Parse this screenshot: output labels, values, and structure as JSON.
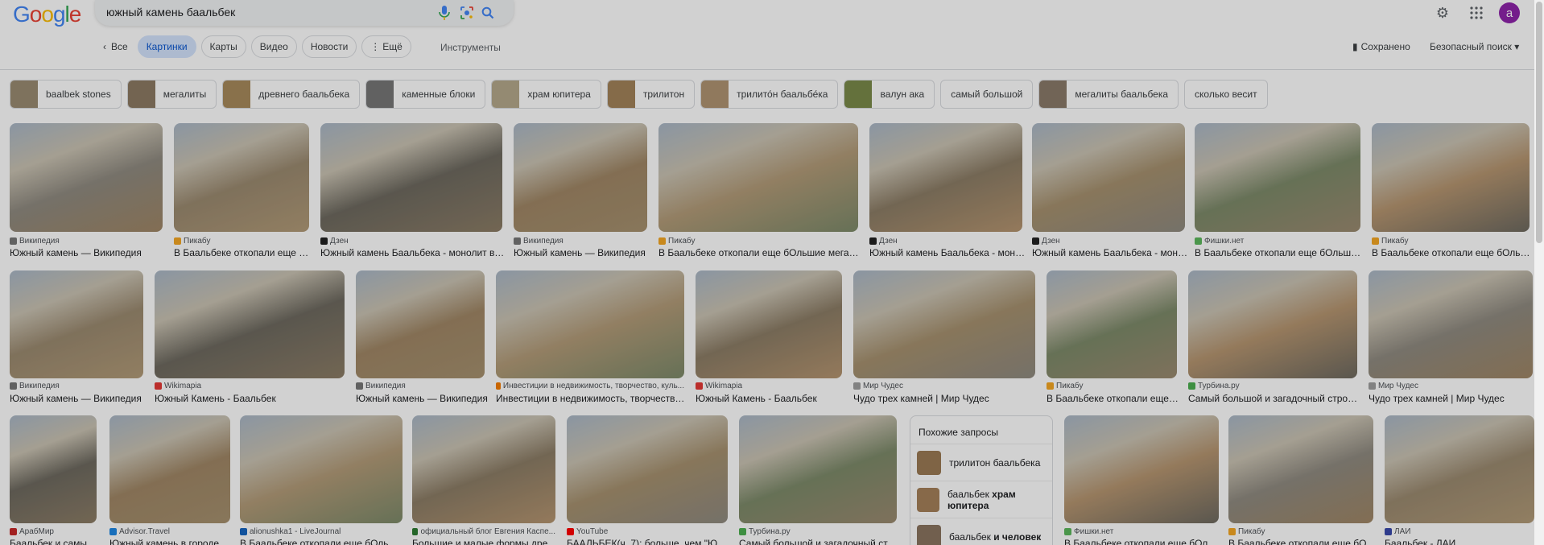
{
  "logo": {
    "letters": [
      "G",
      "o",
      "o",
      "g",
      "l",
      "e"
    ],
    "colors": [
      "#4285F4",
      "#EA4335",
      "#FBBC05",
      "#4285F4",
      "#34A853",
      "#EA4335"
    ]
  },
  "search": {
    "query": "южный камень баальбек"
  },
  "user": {
    "avatar_letter": "a",
    "avatar_color": "#8e24aa"
  },
  "tabs": [
    {
      "label": "Все"
    },
    {
      "label": "Картинки"
    },
    {
      "label": "Карты"
    },
    {
      "label": "Видео"
    },
    {
      "label": "Новости"
    },
    {
      "label": "Ещё"
    }
  ],
  "tools_label": "Инструменты",
  "saved_label": "Сохранено",
  "safesearch_label": "Безопасный поиск",
  "chips": [
    {
      "label": "baalbek stones",
      "thumb": "#9a8b72"
    },
    {
      "label": "мегалиты",
      "thumb": "#8d7a63"
    },
    {
      "label": "древнего баальбека",
      "thumb": "#a88a5c"
    },
    {
      "label": "каменные блоки",
      "thumb": "#777"
    },
    {
      "label": "храм юпитера",
      "thumb": "#b5a98c"
    },
    {
      "label": "трилитон",
      "thumb": "#a3835a"
    },
    {
      "label": "трилито́н баальбе́ка",
      "thumb": "#b09472"
    },
    {
      "label": "валун ака",
      "thumb": "#7a8a4a"
    },
    {
      "label": "самый большой",
      "thumb": ""
    },
    {
      "label": "мегалиты баальбека",
      "thumb": "#8a7a6a"
    },
    {
      "label": "сколько весит",
      "thumb": ""
    }
  ],
  "images_row1": [
    {
      "source": "Википедия",
      "title": "Южный камень — Википедия",
      "fav": "#777"
    },
    {
      "source": "Пикабу",
      "title": "В Баальбеке откопали еще бо...",
      "fav": "#f5a623"
    },
    {
      "source": "Дзен",
      "title": "Южный камень Баальбека - монолит вес...",
      "fav": "#222"
    },
    {
      "source": "Википедия",
      "title": "Южный камень — Википедия",
      "fav": "#777"
    },
    {
      "source": "Пикабу",
      "title": "В Баальбеке откопали еще бОльшие мегалит...",
      "fav": "#f5a623"
    },
    {
      "source": "Дзен",
      "title": "Южный камень Баальбека - моно...",
      "fav": "#222"
    },
    {
      "source": "Дзен",
      "title": "Южный камень Баальбека - моно...",
      "fav": "#222"
    },
    {
      "source": "Фишки.нет",
      "title": "В Баальбеке откопали еще бОльшие ...",
      "fav": "#5cb85c"
    },
    {
      "source": "Пикабу",
      "title": "В Баальбеке откопали еще бОльши...",
      "fav": "#f5a623"
    }
  ],
  "images_row2": [
    {
      "source": "Википедия",
      "title": "Южный камень — Википедия",
      "fav": "#777"
    },
    {
      "source": "Wikimapia",
      "title": "Южный Камень - Баальбек",
      "fav": "#e53935"
    },
    {
      "source": "Википедия",
      "title": "Южный камень — Википедия",
      "fav": "#777"
    },
    {
      "source": "Инвестиции в недвижимость, творчество, куль...",
      "title": "Инвестиции в недвижимость, творчество, ...",
      "fav": "#f57c00"
    },
    {
      "source": "Wikimapia",
      "title": "Южный Камень - Баальбек",
      "fav": "#e53935"
    },
    {
      "source": "Мир Чудес",
      "title": "Чудо трех камней | Мир Чудес",
      "fav": "#9e9e9e"
    },
    {
      "source": "Пикабу",
      "title": "В Баальбеке откопали еще б...",
      "fav": "#f5a623"
    },
    {
      "source": "Турбина.ру",
      "title": "Самый большой и загадочный строит...",
      "fav": "#4caf50"
    },
    {
      "source": "Мир Чудес",
      "title": "Чудо трех камней | Мир Чудес",
      "fav": "#9e9e9e"
    }
  ],
  "images_row3": [
    {
      "source": "АрабМир",
      "title": "Баальбек и самые ...",
      "fav": "#c62828"
    },
    {
      "source": "Advisor.Travel",
      "title": "Южный камень в городе Б...",
      "fav": "#1e88e5"
    },
    {
      "source": "alionushka1 - LiveJournal",
      "title": "В Баальбеке откопали еще бОльшие ...",
      "fav": "#1565c0"
    },
    {
      "source": "официальный блог Евгения Каспе...",
      "title": "Большие и малые формы древ...",
      "fav": "#2e7d32"
    },
    {
      "source": "YouTube",
      "title": "БААЛЬБЕК(ч. 7): больше, чем \"Южн...",
      "fav": "#ff0000"
    },
    {
      "source": "Турбина.ру",
      "title": "Самый большой и загадочный стро...",
      "fav": "#4caf50"
    },
    {
      "source": "Фишки.нет",
      "title": "В Баальбеке откопали еще бОльш...",
      "fav": "#5cb85c"
    },
    {
      "source": "Пикабу",
      "title": "В Баальбеке откопали еще бОль...",
      "fav": "#f5a623"
    },
    {
      "source": "ЛАИ",
      "title": "Баальбек - ЛАИ",
      "fav": "#3949ab"
    }
  ],
  "related": {
    "heading": "Похожие запросы",
    "items": [
      {
        "plain": "трилитон баальбека",
        "bold": ""
      },
      {
        "plain": "баальбек ",
        "bold": "храм юпитера"
      },
      {
        "plain": "баальбек ",
        "bold": "и человек"
      }
    ]
  }
}
